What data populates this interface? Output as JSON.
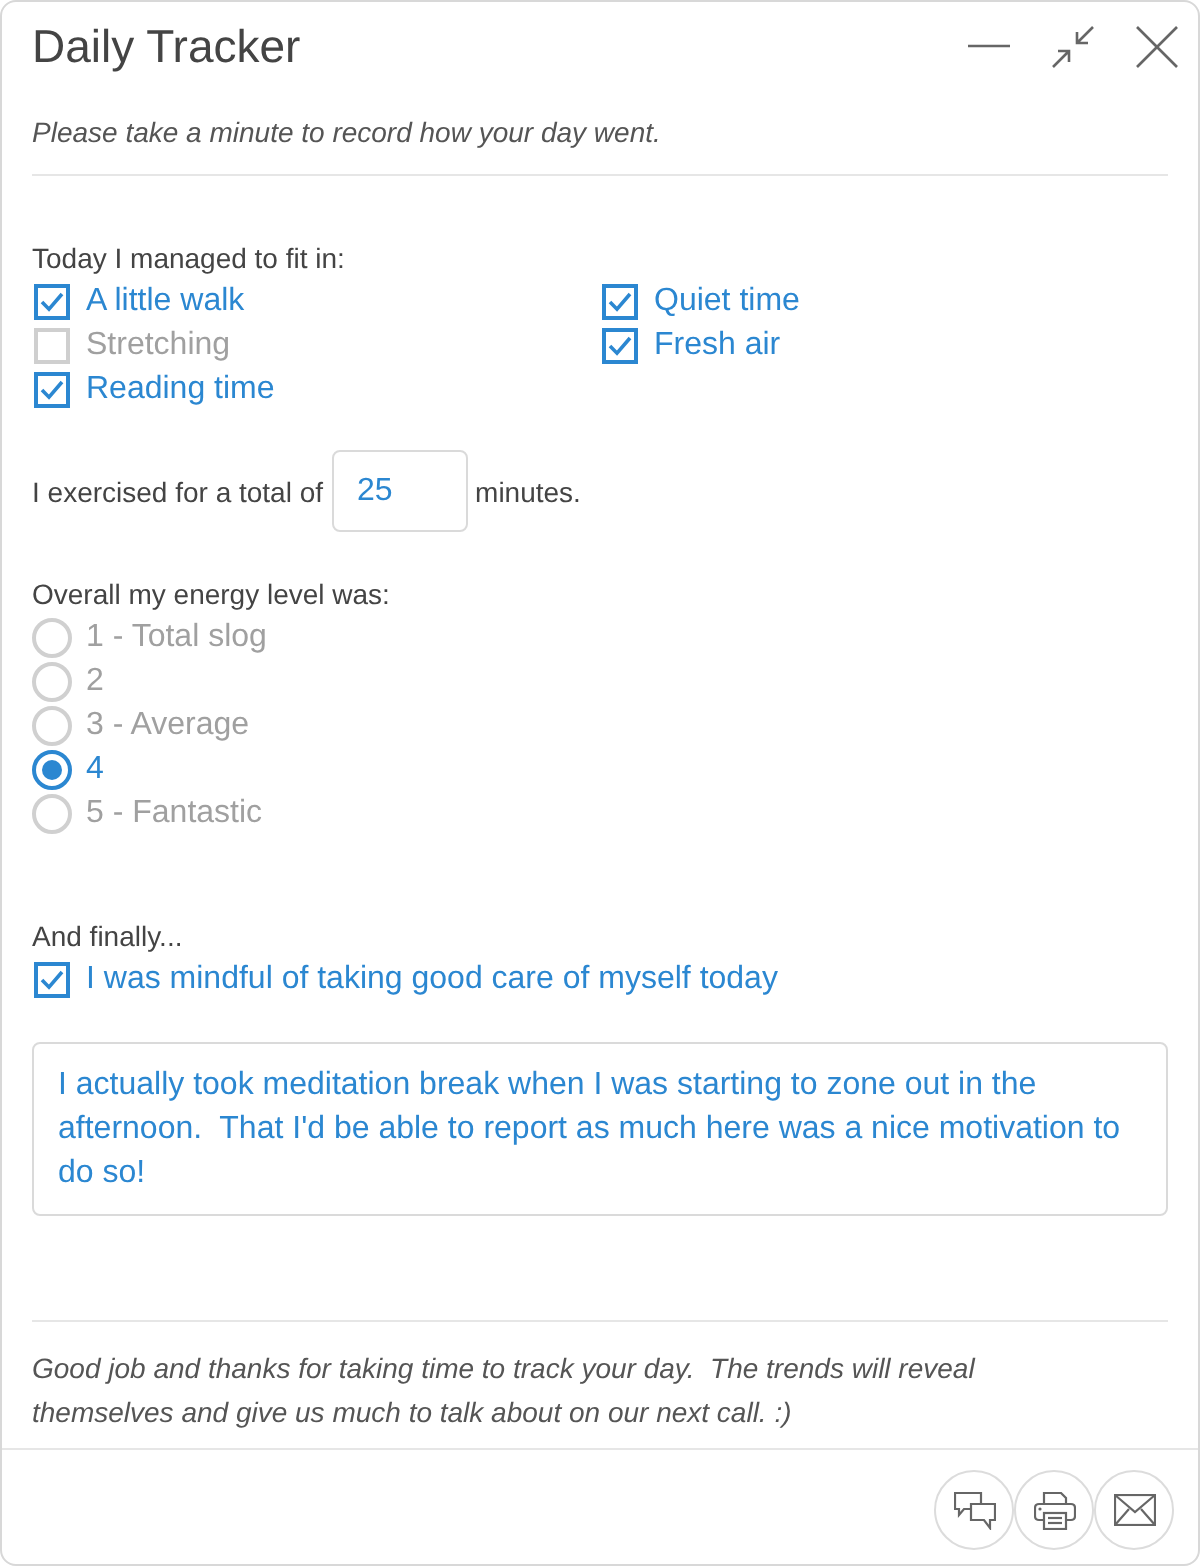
{
  "window": {
    "title": "Daily Tracker"
  },
  "intro": "Please take a minute to record how your day went.",
  "activities": {
    "label": "Today I managed to fit in:",
    "items": [
      {
        "label": "A little walk",
        "checked": true
      },
      {
        "label": "Stretching",
        "checked": false
      },
      {
        "label": "Reading time",
        "checked": true
      },
      {
        "label": "Quiet time",
        "checked": true
      },
      {
        "label": "Fresh air",
        "checked": true
      }
    ]
  },
  "exercise": {
    "prefix": "I exercised for a total of",
    "value": "25",
    "suffix": "minutes."
  },
  "energy": {
    "label": "Overall my energy level was:",
    "options": [
      {
        "label": "1 - Total slog",
        "selected": false
      },
      {
        "label": "2",
        "selected": false
      },
      {
        "label": "3 - Average",
        "selected": false
      },
      {
        "label": "4",
        "selected": true
      },
      {
        "label": "5 - Fantastic",
        "selected": false
      }
    ]
  },
  "finally": {
    "label": "And finally...",
    "item": {
      "label": "I was mindful of taking good care of myself today",
      "checked": true
    },
    "notes": {
      "value": "I actually took meditation break when I was starting to zone out in the afternoon.  That I'd be able to report as much here was a nice motivation to do so!"
    }
  },
  "closing": "Good job and thanks for taking time to track your day.  The trends will reveal themselves and give us much to talk about on our next call. :)"
}
